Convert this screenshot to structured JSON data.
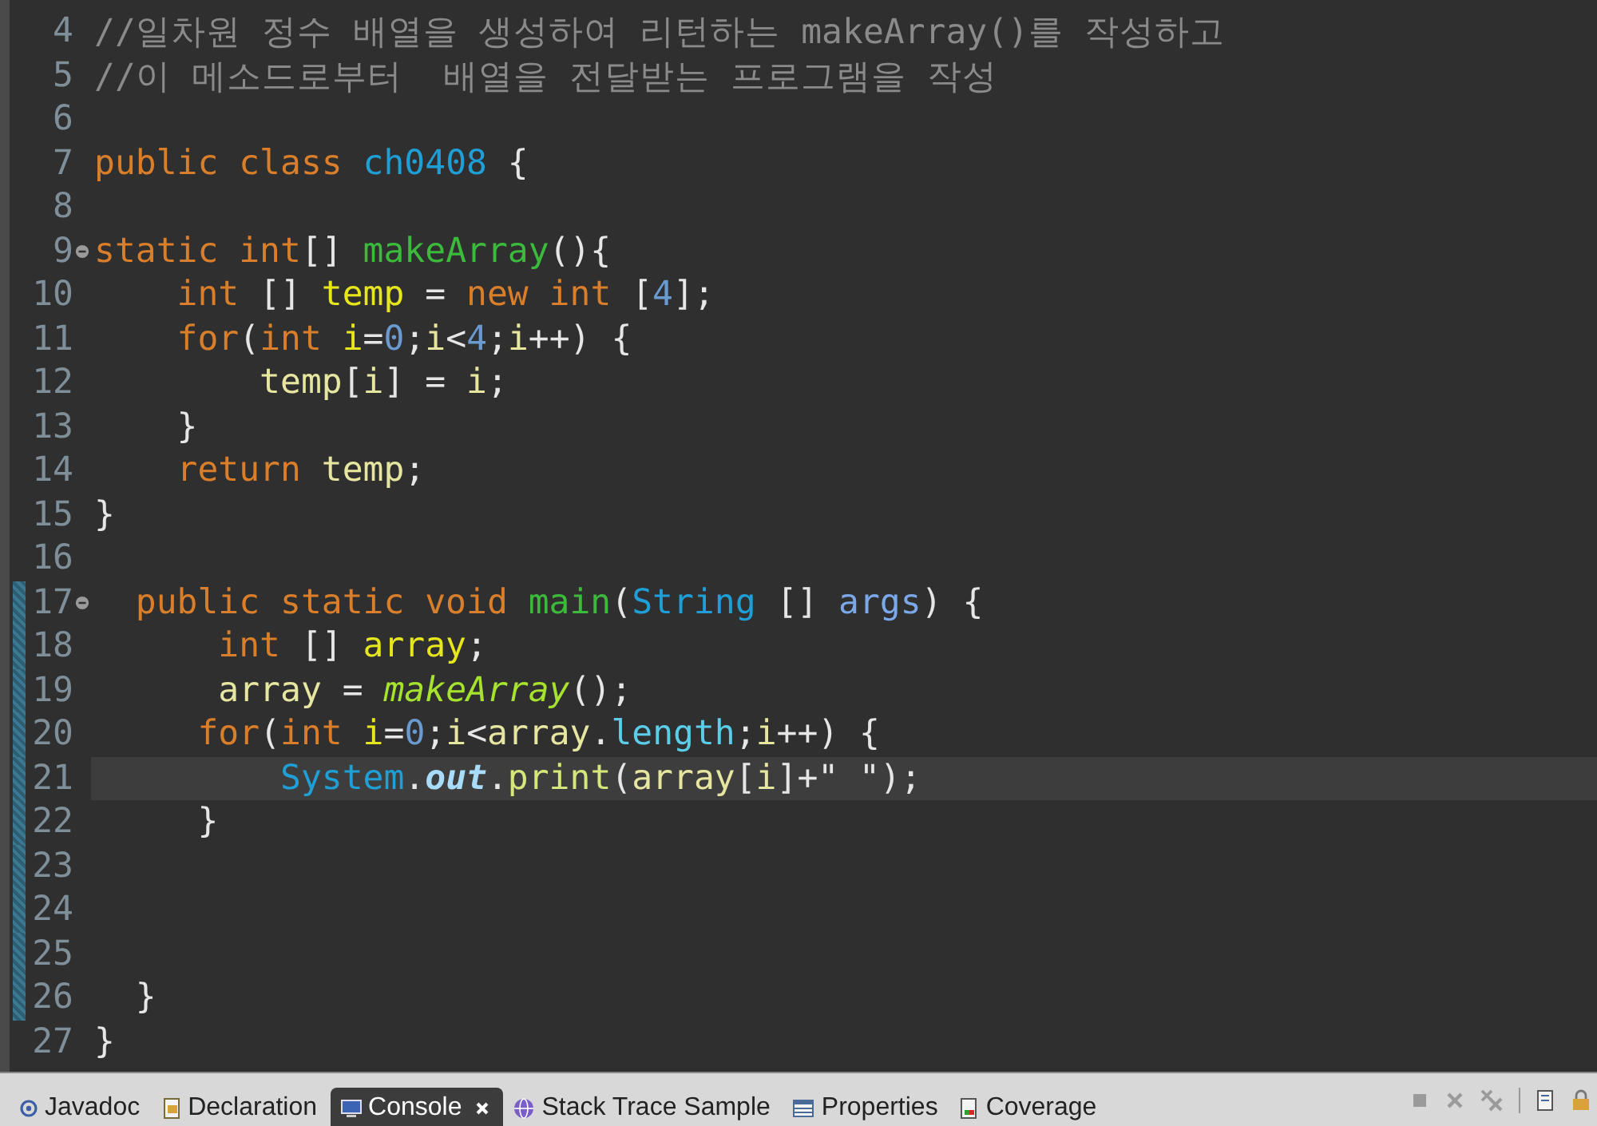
{
  "editor": {
    "lines": [
      {
        "number": "4",
        "tokens": [
          {
            "kind": "comment",
            "text": "//일차원 정수 배열을 생성하여 리턴하는 makeArray()를 작성하고"
          }
        ]
      },
      {
        "number": "5",
        "tokens": [
          {
            "kind": "comment",
            "text": "//이 메소드로부터  배열을 전달받는 프로그램을 작성"
          }
        ]
      },
      {
        "number": "6"
      },
      {
        "number": "7",
        "tokens": [
          {
            "kind": "keyword",
            "text": "public"
          },
          {
            "kind": "keyword",
            "text": " class"
          },
          {
            "kind": "class",
            "text": " ch0408"
          },
          {
            "kind": "plain",
            "text": " {"
          }
        ]
      },
      {
        "number": "8"
      },
      {
        "number": "9",
        "fold": true,
        "tokens": [
          {
            "kind": "keyword",
            "text": "static"
          },
          {
            "kind": "keyword",
            "text": " int"
          },
          {
            "kind": "plain",
            "text": "[]"
          },
          {
            "kind": "method-decl",
            "text": " makeArray"
          },
          {
            "kind": "plain",
            "text": "(){"
          }
        ]
      },
      {
        "number": "10",
        "tokens": [
          {
            "kind": "keyword",
            "text": "    int"
          },
          {
            "kind": "plain",
            "text": " [] "
          },
          {
            "kind": "local-decl",
            "text": "temp"
          },
          {
            "kind": "plain",
            "text": " = "
          },
          {
            "kind": "keyword",
            "text": "new"
          },
          {
            "kind": "keyword",
            "text": " int"
          },
          {
            "kind": "plain",
            "text": " ["
          },
          {
            "kind": "number",
            "text": "4"
          },
          {
            "kind": "plain",
            "text": "];"
          }
        ]
      },
      {
        "number": "11",
        "tokens": [
          {
            "kind": "keyword",
            "text": "    for"
          },
          {
            "kind": "plain",
            "text": "("
          },
          {
            "kind": "keyword",
            "text": "int"
          },
          {
            "kind": "local-decl",
            "text": " i"
          },
          {
            "kind": "plain",
            "text": "="
          },
          {
            "kind": "number",
            "text": "0"
          },
          {
            "kind": "plain",
            "text": ";"
          },
          {
            "kind": "local",
            "text": "i"
          },
          {
            "kind": "plain",
            "text": "<"
          },
          {
            "kind": "number",
            "text": "4"
          },
          {
            "kind": "plain",
            "text": ";"
          },
          {
            "kind": "local",
            "text": "i"
          },
          {
            "kind": "plain",
            "text": "++) {"
          }
        ]
      },
      {
        "number": "12",
        "tokens": [
          {
            "kind": "local",
            "text": "        temp"
          },
          {
            "kind": "plain",
            "text": "["
          },
          {
            "kind": "local",
            "text": "i"
          },
          {
            "kind": "plain",
            "text": "] = "
          },
          {
            "kind": "local",
            "text": "i"
          },
          {
            "kind": "plain",
            "text": ";"
          }
        ]
      },
      {
        "number": "13",
        "tokens": [
          {
            "kind": "plain",
            "text": "    }"
          }
        ]
      },
      {
        "number": "14",
        "tokens": [
          {
            "kind": "keyword",
            "text": "    return"
          },
          {
            "kind": "local",
            "text": " temp"
          },
          {
            "kind": "plain",
            "text": ";"
          }
        ]
      },
      {
        "number": "15",
        "tokens": [
          {
            "kind": "plain",
            "text": "}"
          }
        ]
      },
      {
        "number": "16"
      },
      {
        "number": "17",
        "fold": true,
        "changed": true,
        "tokens": [
          {
            "kind": "keyword",
            "text": "  public"
          },
          {
            "kind": "keyword",
            "text": " static"
          },
          {
            "kind": "keyword",
            "text": " void"
          },
          {
            "kind": "method-decl",
            "text": " main"
          },
          {
            "kind": "plain",
            "text": "("
          },
          {
            "kind": "class",
            "text": "String"
          },
          {
            "kind": "plain",
            "text": " [] "
          },
          {
            "kind": "param",
            "text": "args"
          },
          {
            "kind": "plain",
            "text": ") {"
          }
        ]
      },
      {
        "number": "18",
        "changed": true,
        "tokens": [
          {
            "kind": "keyword",
            "text": "      int"
          },
          {
            "kind": "plain",
            "text": " [] "
          },
          {
            "kind": "local-decl",
            "text": "array"
          },
          {
            "kind": "plain",
            "text": ";"
          }
        ]
      },
      {
        "number": "19",
        "changed": true,
        "tokens": [
          {
            "kind": "local",
            "text": "      array"
          },
          {
            "kind": "plain",
            "text": " = "
          },
          {
            "kind": "method-static",
            "text": "makeArray"
          },
          {
            "kind": "plain",
            "text": "();"
          }
        ]
      },
      {
        "number": "20",
        "changed": true,
        "tokens": [
          {
            "kind": "keyword",
            "text": "     for"
          },
          {
            "kind": "plain",
            "text": "("
          },
          {
            "kind": "keyword",
            "text": "int"
          },
          {
            "kind": "local-decl",
            "text": " i"
          },
          {
            "kind": "plain",
            "text": "="
          },
          {
            "kind": "number",
            "text": "0"
          },
          {
            "kind": "plain",
            "text": ";"
          },
          {
            "kind": "local",
            "text": "i"
          },
          {
            "kind": "plain",
            "text": "<"
          },
          {
            "kind": "local",
            "text": "array"
          },
          {
            "kind": "plain",
            "text": "."
          },
          {
            "kind": "field",
            "text": "length"
          },
          {
            "kind": "plain",
            "text": ";"
          },
          {
            "kind": "local",
            "text": "i"
          },
          {
            "kind": "plain",
            "text": "++) {"
          }
        ]
      },
      {
        "number": "21",
        "changed": true,
        "current": true,
        "tokens": [
          {
            "kind": "class",
            "text": "         System"
          },
          {
            "kind": "plain",
            "text": "."
          },
          {
            "kind": "field-static",
            "text": "out"
          },
          {
            "kind": "plain",
            "text": "."
          },
          {
            "kind": "method-call",
            "text": "print"
          },
          {
            "kind": "plain",
            "text": "("
          },
          {
            "kind": "local",
            "text": "array"
          },
          {
            "kind": "plain",
            "text": "["
          },
          {
            "kind": "local",
            "text": "i"
          },
          {
            "kind": "plain",
            "text": "]+"
          },
          {
            "kind": "string",
            "text": "\" \""
          },
          {
            "kind": "plain",
            "text": ");"
          }
        ]
      },
      {
        "number": "22",
        "changed": true,
        "tokens": [
          {
            "kind": "plain",
            "text": "     }"
          }
        ]
      },
      {
        "number": "23",
        "changed": true
      },
      {
        "number": "24",
        "changed": true
      },
      {
        "number": "25",
        "changed": true
      },
      {
        "number": "26",
        "changed": true,
        "tokens": [
          {
            "kind": "plain",
            "text": "  }"
          }
        ]
      },
      {
        "number": "27",
        "tokens": [
          {
            "kind": "plain",
            "text": "}"
          }
        ]
      }
    ]
  },
  "tabs": [
    {
      "kind": "javadoc",
      "label": "Javadoc",
      "selected": false
    },
    {
      "kind": "declaration",
      "label": "Declaration",
      "selected": false
    },
    {
      "kind": "console",
      "label": "Console",
      "selected": true
    },
    {
      "kind": "stack-trace",
      "label": "Stack Trace Sample",
      "selected": false
    },
    {
      "kind": "properties",
      "label": "Properties",
      "selected": false
    },
    {
      "kind": "coverage",
      "label": "Coverage",
      "selected": false
    }
  ]
}
